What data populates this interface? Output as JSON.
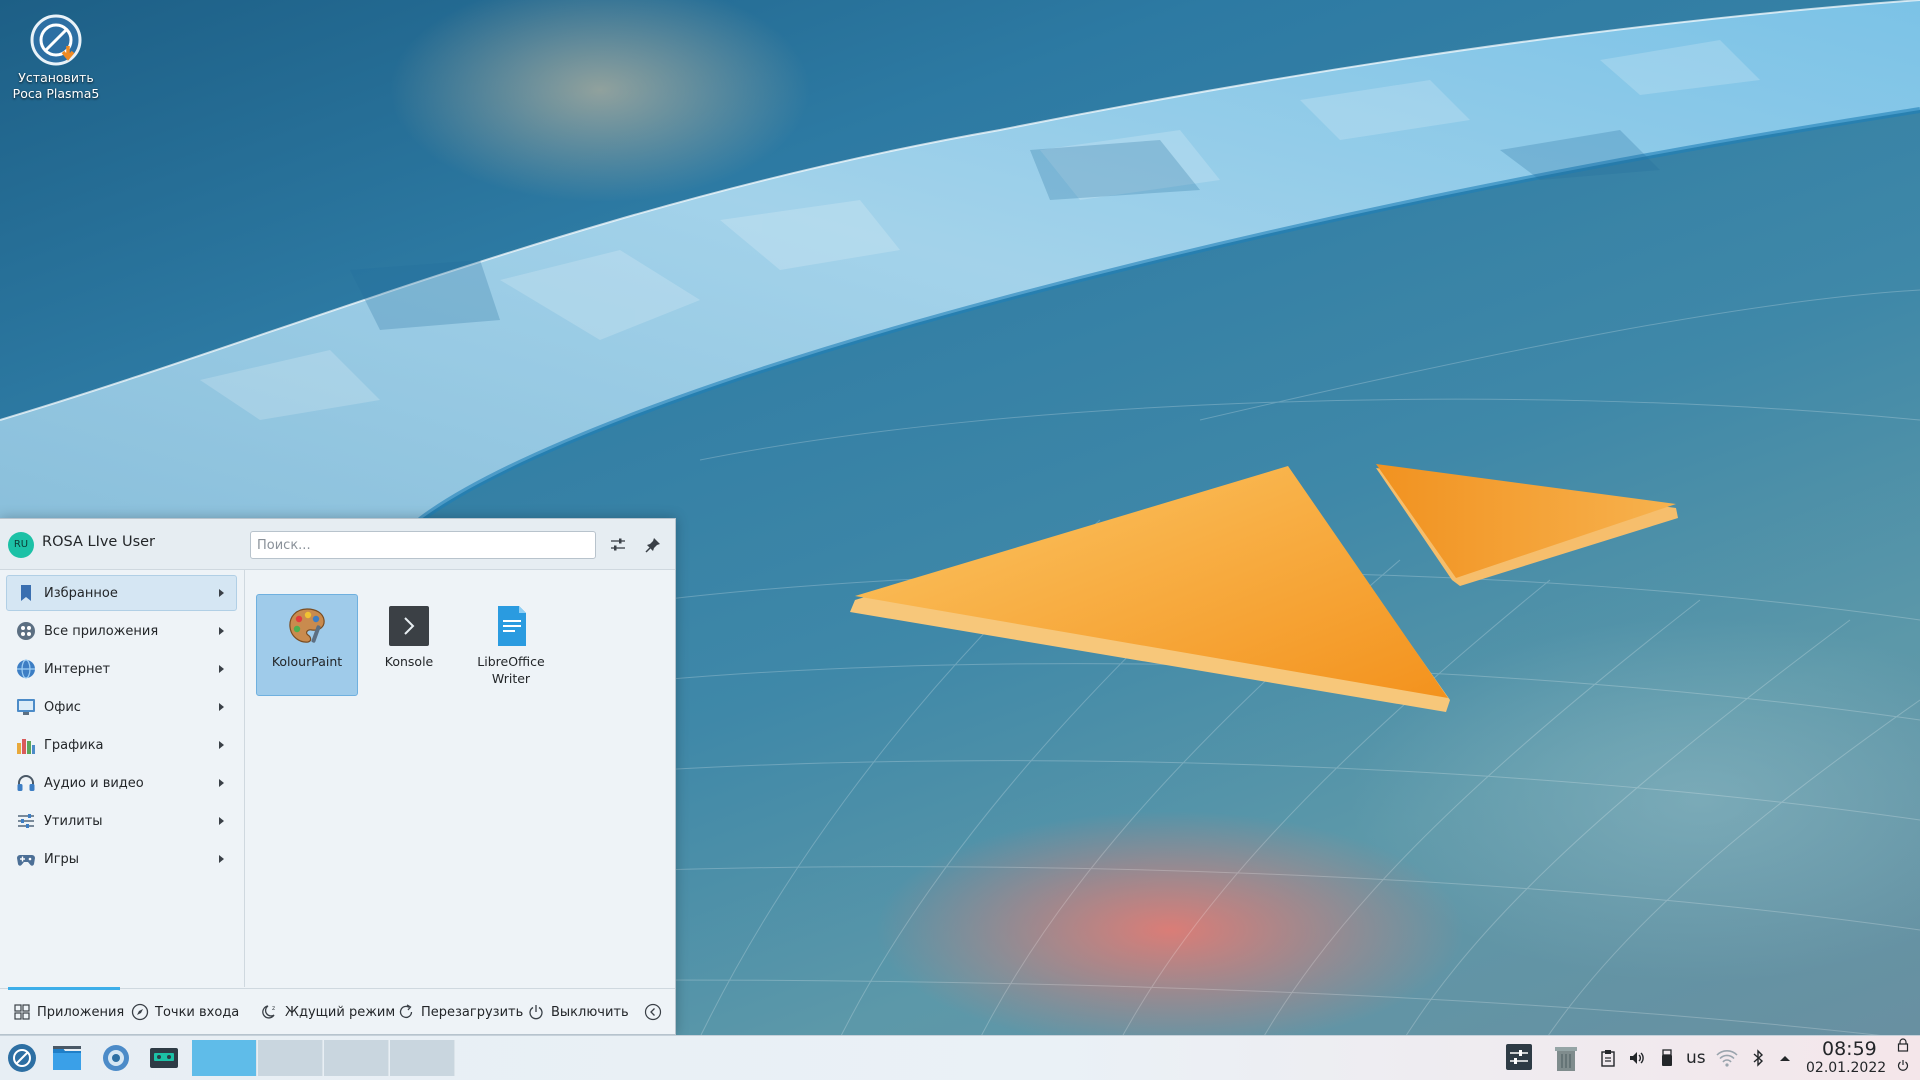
{
  "desktop": {
    "icon_label_line1": "Установить",
    "icon_label_line2": "Роса Plasma5"
  },
  "launcher": {
    "avatar_text": "RU",
    "username": "ROSA LIve User",
    "search_placeholder": "Поиск...",
    "categories": [
      {
        "label": "Избранное",
        "icon": "bookmark-icon"
      },
      {
        "label": "Все приложения",
        "icon": "apps-icon"
      },
      {
        "label": "Интернет",
        "icon": "globe-icon"
      },
      {
        "label": "Офис",
        "icon": "office-icon"
      },
      {
        "label": "Графика",
        "icon": "graphics-icon"
      },
      {
        "label": "Аудио и видео",
        "icon": "headphones-icon"
      },
      {
        "label": "Утилиты",
        "icon": "utilities-icon"
      },
      {
        "label": "Игры",
        "icon": "gamepad-icon"
      }
    ],
    "apps": [
      {
        "label": "KolourPaint",
        "icon": "palette-icon"
      },
      {
        "label": "Konsole",
        "icon": "terminal-icon"
      },
      {
        "label_line1": "LibreOffice",
        "label_line2": "Writer",
        "icon": "writer-icon"
      }
    ],
    "footer": {
      "applications": "Приложения",
      "places": "Точки входа",
      "sleep": "Ждущий режим",
      "restart": "Перезагрузить",
      "shutdown": "Выключить"
    }
  },
  "taskbar": {
    "keyboard_layout": "us",
    "time": "08:59",
    "date": "02.01.2022"
  },
  "colors": {
    "accent": "#3daee9",
    "selection": "#9fcbea",
    "avatar": "#1cc1a6",
    "wallpaper_orange": "#f4a43a"
  }
}
